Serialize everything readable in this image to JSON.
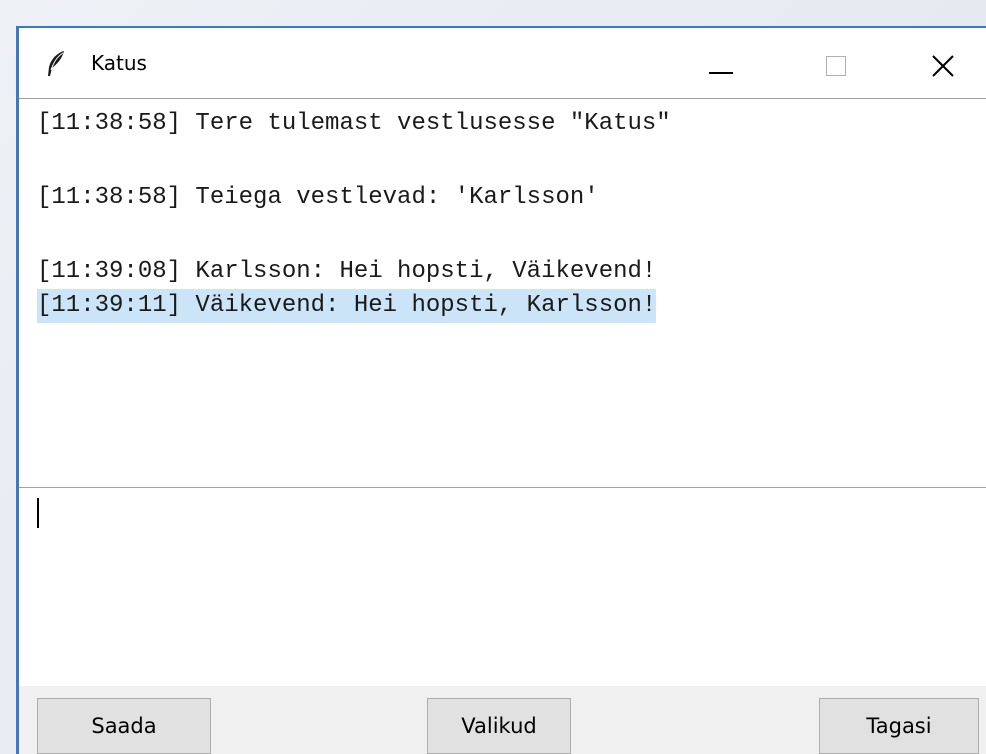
{
  "window": {
    "title": "Katus",
    "icon": "feather-icon"
  },
  "chat": {
    "lines": [
      {
        "text": "[11:38:58] Tere tulemast vestlusesse \"Katus\"",
        "selected": false
      },
      {
        "text": "[11:38:58] Teiega vestlevad: 'Karlsson'",
        "selected": false
      },
      {
        "text": "[11:39:08] Karlsson: Hei hopsti, Väikevend!",
        "selected": false
      },
      {
        "text": "[11:39:11] Väikevend: Hei hopsti, Karlsson!",
        "selected": true
      }
    ]
  },
  "input": {
    "value": ""
  },
  "buttons": {
    "send": "Saada",
    "options": "Valikud",
    "back": "Tagasi"
  },
  "colors": {
    "accent": "#3a78c9",
    "selection": "#cce4f7"
  }
}
